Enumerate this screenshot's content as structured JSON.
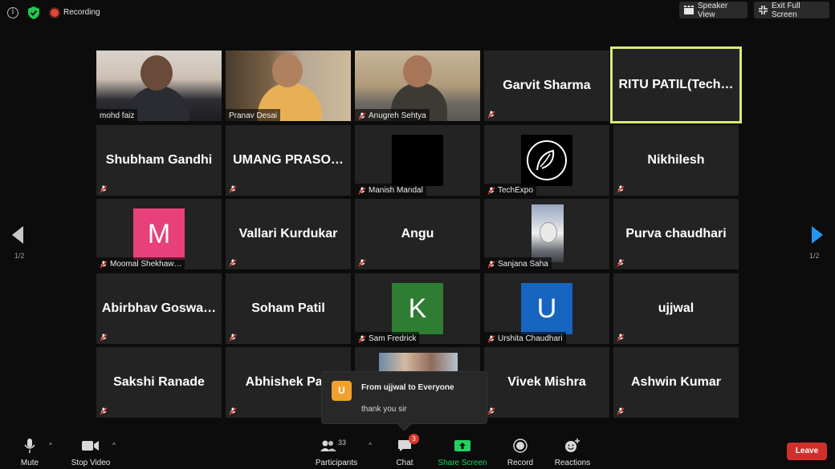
{
  "topbar": {
    "recording_label": "Recording",
    "speaker_view_label": "Speaker View",
    "exit_full_screen_label": "Exit Full Screen"
  },
  "pagination": {
    "left": "1/2",
    "right": "1/2"
  },
  "tiles": [
    {
      "name": "mohd faiz",
      "type": "video"
    },
    {
      "name": "Pranav Desai",
      "type": "video"
    },
    {
      "name": "Anugreh Sehtya",
      "type": "video",
      "muted": true
    },
    {
      "name": "Garvit Sharma",
      "type": "name",
      "muted": true
    },
    {
      "name": "RITU  PATIL(Tech…",
      "type": "name",
      "active": true
    },
    {
      "name": "Shubham Gandhi",
      "type": "name",
      "muted": true
    },
    {
      "name": "UMANG  PRASO…",
      "type": "name",
      "muted": true
    },
    {
      "name": "Manish Mandal",
      "type": "avatar",
      "avatar": "black-square",
      "muted": true
    },
    {
      "name": "TechExpo",
      "type": "avatar",
      "avatar": "leaf-logo-icon",
      "muted": true
    },
    {
      "name": "Nikhilesh",
      "type": "name",
      "muted": true
    },
    {
      "name": "Moomal Shekhaw…",
      "type": "avatar",
      "avatar_letter": "M",
      "avatar_color": "#e8407a",
      "muted": true
    },
    {
      "name": "Vallari Kurdukar",
      "type": "name",
      "muted": true
    },
    {
      "name": "Angu",
      "type": "name",
      "muted": true
    },
    {
      "name": "Sanjana Saha",
      "type": "avatar",
      "avatar": "astronaut-image",
      "muted": true
    },
    {
      "name": "Purva chaudhari",
      "type": "name",
      "muted": true
    },
    {
      "name": "Abirbhav  Goswa…",
      "type": "name",
      "muted": true
    },
    {
      "name": "Soham Patil",
      "type": "name",
      "muted": true
    },
    {
      "name": "Sam Fredrick",
      "type": "avatar",
      "avatar_letter": "K",
      "avatar_color": "#2e7d32",
      "muted": true
    },
    {
      "name": "Urshita Chaudhari",
      "type": "avatar",
      "avatar_letter": "U",
      "avatar_color": "#1565c0",
      "muted": true
    },
    {
      "name": "ujjwal",
      "type": "name",
      "muted": true
    },
    {
      "name": "Sakshi Ranade",
      "type": "name",
      "muted": true
    },
    {
      "name": "Abhishek  Patt",
      "type": "name",
      "muted": true
    },
    {
      "name": "Vivek Mishra",
      "type": "name",
      "muted": true
    },
    {
      "name": "Ashwin Kumar",
      "type": "name",
      "muted": true
    }
  ],
  "chat_toast": {
    "avatar_letter": "U",
    "from": "From ujjwal to Everyone",
    "message": "thank you sir"
  },
  "toolbar": {
    "mute_label": "Mute",
    "stop_video_label": "Stop Video",
    "participants_label": "Participants",
    "participants_count": "33",
    "chat_label": "Chat",
    "chat_badge": "3",
    "share_screen_label": "Share Screen",
    "record_label": "Record",
    "reactions_label": "Reactions",
    "leave_label": "Leave"
  },
  "colors": {
    "active_speaker": "#d6ec7a",
    "share_green": "#23d160",
    "leave_red": "#d0302b",
    "next_arrow": "#2196f3"
  }
}
